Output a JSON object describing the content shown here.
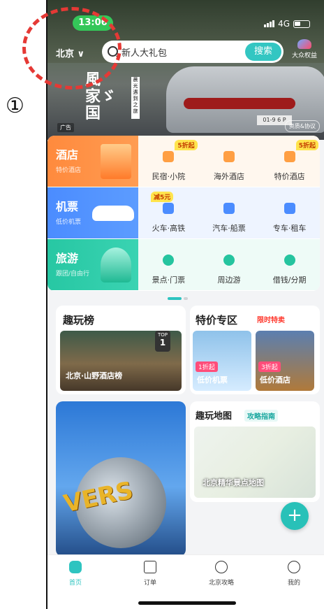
{
  "annotation": {
    "marker": "①"
  },
  "status_bar": {
    "time": "13:06",
    "network": "4G"
  },
  "header": {
    "city": "北京 ∨",
    "search": {
      "placeholder": "新人大礼包",
      "button": "搜索"
    },
    "perk_label": "大众权益"
  },
  "banner": {
    "title_lines": [
      "風",
      "家ゞ",
      "国"
    ],
    "title_art": "遇见礼",
    "tag": "晨光遇到之旅",
    "ad_tag": "广告",
    "protocol": "资质&协议",
    "plate": "01-9 6 P"
  },
  "categories": [
    {
      "main": {
        "title": "酒店",
        "subtitle": "特价酒店"
      },
      "subs": [
        {
          "label": "民宿·小院",
          "badge": "5折起",
          "icon": "house-icon"
        },
        {
          "label": "海外酒店",
          "badge": "",
          "icon": "building-icon"
        },
        {
          "label": "特价酒店",
          "badge": "5折起",
          "icon": "hotel-icon"
        }
      ]
    },
    {
      "main": {
        "title": "机票",
        "subtitle": "低价机票"
      },
      "subs": [
        {
          "label": "火车·高铁",
          "badge": "减5元",
          "icon": "train-icon"
        },
        {
          "label": "汽车·船票",
          "badge": "",
          "icon": "bus-icon"
        },
        {
          "label": "专车·租车",
          "badge": "",
          "icon": "car-icon"
        }
      ]
    },
    {
      "main": {
        "title": "旅游",
        "subtitle": "跟团/自由行"
      },
      "subs": [
        {
          "label": "景点·门票",
          "badge": "",
          "icon": "ticket-icon"
        },
        {
          "label": "周边游",
          "badge": "",
          "icon": "pin-icon"
        },
        {
          "label": "借钱/分期",
          "badge": "",
          "icon": "wallet-icon"
        }
      ]
    }
  ],
  "sections": {
    "fun_list": {
      "title": "趣玩榜",
      "photo_label": "北京·山野酒店榜",
      "top_label": "TOP",
      "top_rank": "1"
    },
    "deals": {
      "title": "特价专区",
      "limited": "限时特卖",
      "items": [
        {
          "label": "低价机票",
          "tag": "1折起"
        },
        {
          "label": "低价酒店",
          "tag": "3折起"
        }
      ]
    },
    "universal": {
      "sign": "VERS"
    },
    "map": {
      "title": "趣玩地图",
      "guide": "攻略指南",
      "label": "北京精华景点地图"
    }
  },
  "fab": {
    "symbol": "+"
  },
  "tabbar": [
    {
      "label": "首页",
      "icon": "home-icon",
      "active": true
    },
    {
      "label": "订单",
      "icon": "order-icon",
      "active": false
    },
    {
      "label": "北京攻略",
      "icon": "location-icon",
      "active": false
    },
    {
      "label": "我的",
      "icon": "profile-icon",
      "active": false
    }
  ],
  "colors": {
    "accent": "#2ec4c0",
    "hotel": "#ff8a3d",
    "flight": "#4b8cff",
    "travel": "#27c7a3",
    "annotation": "#e53935"
  }
}
